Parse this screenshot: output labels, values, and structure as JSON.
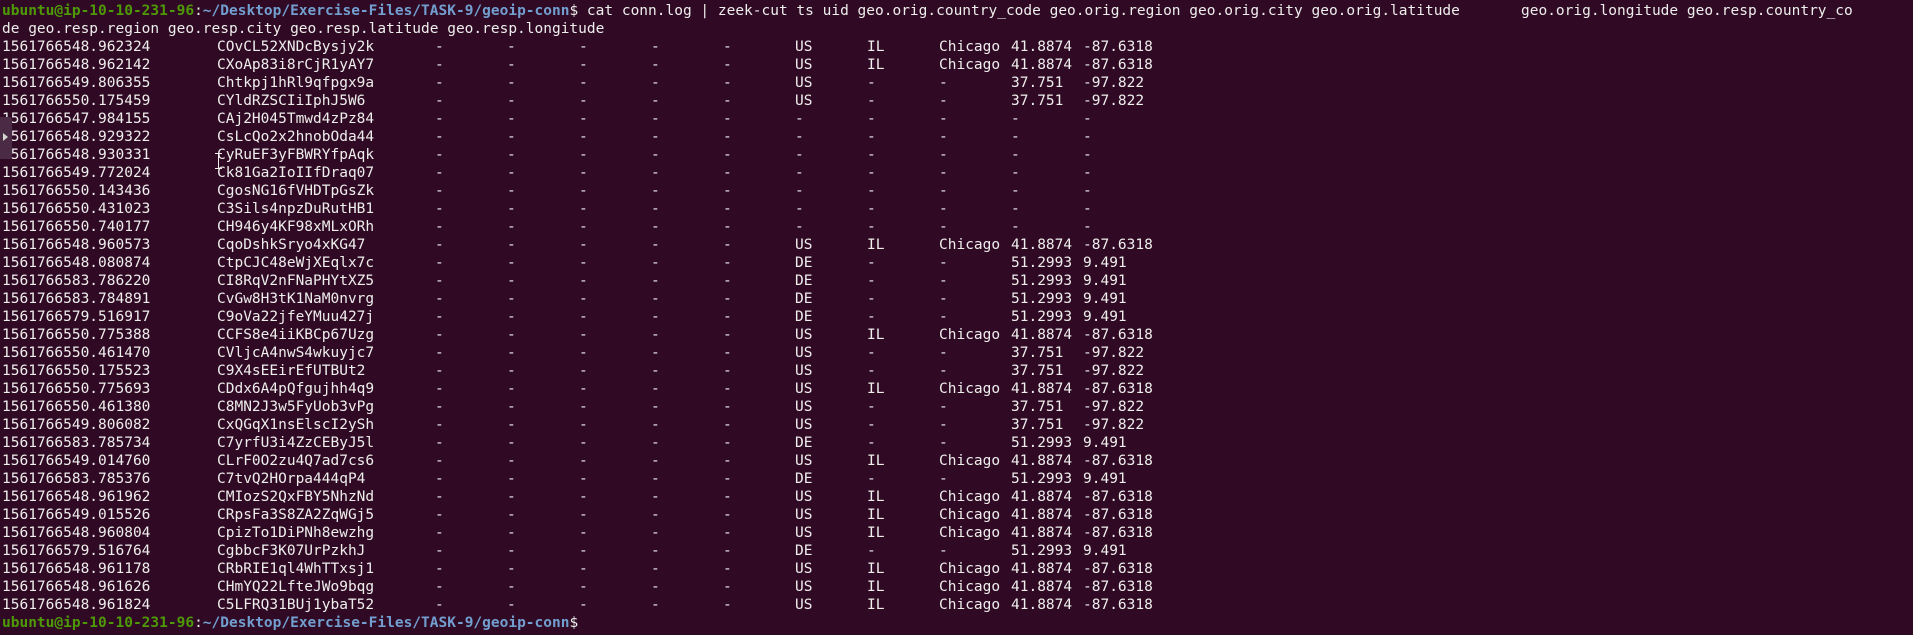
{
  "prompt": {
    "user_host": "ubuntu@ip-10-10-231-96",
    "colon": ":",
    "cwd": "~/Desktop/Exercise-Files/TASK-9/geoip-conn",
    "symbol": "$"
  },
  "command": {
    "line1": " cat conn.log | zeek-cut ts uid geo.orig.country_code geo.orig.region geo.orig.city geo.orig.latitude       geo.orig.longitude geo.resp.country_co",
    "line2": "de geo.resp.region geo.resp.city geo.resp.latitude geo.resp.longitude"
  },
  "rows": [
    [
      "1561766548.962324",
      "COvCL52XNDcBysjy2k",
      "-",
      "-",
      "-",
      "-",
      "-",
      "US",
      "IL",
      "Chicago",
      "41.8874",
      "-87.6318"
    ],
    [
      "1561766548.962142",
      "CXoAp83i8rCjR1yAY7",
      "-",
      "-",
      "-",
      "-",
      "-",
      "US",
      "IL",
      "Chicago",
      "41.8874",
      "-87.6318"
    ],
    [
      "1561766549.806355",
      "Chtkpj1hRl9qfpgx9a",
      "-",
      "-",
      "-",
      "-",
      "-",
      "US",
      "-",
      "-",
      "37.751",
      "-97.822"
    ],
    [
      "1561766550.175459",
      "CYldRZSCIiIphJ5W6",
      "-",
      "-",
      "-",
      "-",
      "-",
      "US",
      "-",
      "-",
      "37.751",
      "-97.822"
    ],
    [
      "1561766547.984155",
      "CAj2H045Tmwd4zPz84",
      "-",
      "-",
      "-",
      "-",
      "-",
      "-",
      "-",
      "-",
      "-",
      "-"
    ],
    [
      "1561766548.929322",
      "CsLcQo2x2hnobOda44",
      "-",
      "-",
      "-",
      "-",
      "-",
      "-",
      "-",
      "-",
      "-",
      "-"
    ],
    [
      "1561766548.930331",
      "CyRuEF3yFBWRYfpAqk",
      "-",
      "-",
      "-",
      "-",
      "-",
      "-",
      "-",
      "-",
      "-",
      "-"
    ],
    [
      "1561766549.772024",
      "Ck81Ga2IoIIfDraq07",
      "-",
      "-",
      "-",
      "-",
      "-",
      "-",
      "-",
      "-",
      "-",
      "-"
    ],
    [
      "1561766550.143436",
      "CgosNG16fVHDTpGsZk",
      "-",
      "-",
      "-",
      "-",
      "-",
      "-",
      "-",
      "-",
      "-",
      "-"
    ],
    [
      "1561766550.431023",
      "C3Sils4npzDuRutHB1",
      "-",
      "-",
      "-",
      "-",
      "-",
      "-",
      "-",
      "-",
      "-",
      "-"
    ],
    [
      "1561766550.740177",
      "CH946y4KF98xMLxORh",
      "-",
      "-",
      "-",
      "-",
      "-",
      "-",
      "-",
      "-",
      "-",
      "-"
    ],
    [
      "1561766548.960573",
      "CqoDshkSryo4xKG47",
      "-",
      "-",
      "-",
      "-",
      "-",
      "US",
      "IL",
      "Chicago",
      "41.8874",
      "-87.6318"
    ],
    [
      "1561766548.080874",
      "CtpCJC48eWjXEqlx7c",
      "-",
      "-",
      "-",
      "-",
      "-",
      "DE",
      "-",
      "-",
      "51.2993",
      "9.491"
    ],
    [
      "1561766583.786220",
      "CI8RqV2nFNaPHYtXZ5",
      "-",
      "-",
      "-",
      "-",
      "-",
      "DE",
      "-",
      "-",
      "51.2993",
      "9.491"
    ],
    [
      "1561766583.784891",
      "CvGw8H3tK1NaM0nvrg",
      "-",
      "-",
      "-",
      "-",
      "-",
      "DE",
      "-",
      "-",
      "51.2993",
      "9.491"
    ],
    [
      "1561766579.516917",
      "C9oVa22jfeYMuu427j",
      "-",
      "-",
      "-",
      "-",
      "-",
      "DE",
      "-",
      "-",
      "51.2993",
      "9.491"
    ],
    [
      "1561766550.775388",
      "CCFS8e4iiKBCp67Uzg",
      "-",
      "-",
      "-",
      "-",
      "-",
      "US",
      "IL",
      "Chicago",
      "41.8874",
      "-87.6318"
    ],
    [
      "1561766550.461470",
      "CVljcA4nwS4wkuyjc7",
      "-",
      "-",
      "-",
      "-",
      "-",
      "US",
      "-",
      "-",
      "37.751",
      "-97.822"
    ],
    [
      "1561766550.175523",
      "C9X4sEEirEfUTBUt2",
      "-",
      "-",
      "-",
      "-",
      "-",
      "US",
      "-",
      "-",
      "37.751",
      "-97.822"
    ],
    [
      "1561766550.775693",
      "CDdx6A4pQfgujhh4q9",
      "-",
      "-",
      "-",
      "-",
      "-",
      "US",
      "IL",
      "Chicago",
      "41.8874",
      "-87.6318"
    ],
    [
      "1561766550.461380",
      "C8MN2J3w5FyUob3vPg",
      "-",
      "-",
      "-",
      "-",
      "-",
      "US",
      "-",
      "-",
      "37.751",
      "-97.822"
    ],
    [
      "1561766549.806082",
      "CxQGqX1nsElscI2ySh",
      "-",
      "-",
      "-",
      "-",
      "-",
      "US",
      "-",
      "-",
      "37.751",
      "-97.822"
    ],
    [
      "1561766583.785734",
      "C7yrfU3i4ZzCEByJ5l",
      "-",
      "-",
      "-",
      "-",
      "-",
      "DE",
      "-",
      "-",
      "51.2993",
      "9.491"
    ],
    [
      "1561766549.014760",
      "CLrF0O2zu4Q7ad7cs6",
      "-",
      "-",
      "-",
      "-",
      "-",
      "US",
      "IL",
      "Chicago",
      "41.8874",
      "-87.6318"
    ],
    [
      "1561766583.785376",
      "C7tvQ2HOrpa444qP4",
      "-",
      "-",
      "-",
      "-",
      "-",
      "DE",
      "-",
      "-",
      "51.2993",
      "9.491"
    ],
    [
      "1561766548.961962",
      "CMIozS2QxFBY5NhzNd",
      "-",
      "-",
      "-",
      "-",
      "-",
      "US",
      "IL",
      "Chicago",
      "41.8874",
      "-87.6318"
    ],
    [
      "1561766549.015526",
      "CRpsFa3S8ZA2ZqWGj5",
      "-",
      "-",
      "-",
      "-",
      "-",
      "US",
      "IL",
      "Chicago",
      "41.8874",
      "-87.6318"
    ],
    [
      "1561766548.960804",
      "CpizTo1DiPNh8ewzhg",
      "-",
      "-",
      "-",
      "-",
      "-",
      "US",
      "IL",
      "Chicago",
      "41.8874",
      "-87.6318"
    ],
    [
      "1561766579.516764",
      "CgbbcF3K07UrPzkhJ",
      "-",
      "-",
      "-",
      "-",
      "-",
      "DE",
      "-",
      "-",
      "51.2993",
      "9.491"
    ],
    [
      "1561766548.961178",
      "CRbRIE1ql4WhTTxsj1",
      "-",
      "-",
      "-",
      "-",
      "-",
      "US",
      "IL",
      "Chicago",
      "41.8874",
      "-87.6318"
    ],
    [
      "1561766548.961626",
      "CHmYQ22LfteJWo9bqg",
      "-",
      "-",
      "-",
      "-",
      "-",
      "US",
      "IL",
      "Chicago",
      "41.8874",
      "-87.6318"
    ],
    [
      "1561766548.961824",
      "C5LFRQ31BUj1ybaT52",
      "-",
      "-",
      "-",
      "-",
      "-",
      "US",
      "IL",
      "Chicago",
      "41.8874",
      "-87.6318"
    ]
  ],
  "colors": {
    "background": "#300a24",
    "text": "#eeeeec",
    "prompt_user": "#4e9a06",
    "prompt_path": "#729fcf"
  },
  "icons": {
    "side_handle": "chevron-right-icon",
    "cursor": "text-cursor-icon"
  }
}
